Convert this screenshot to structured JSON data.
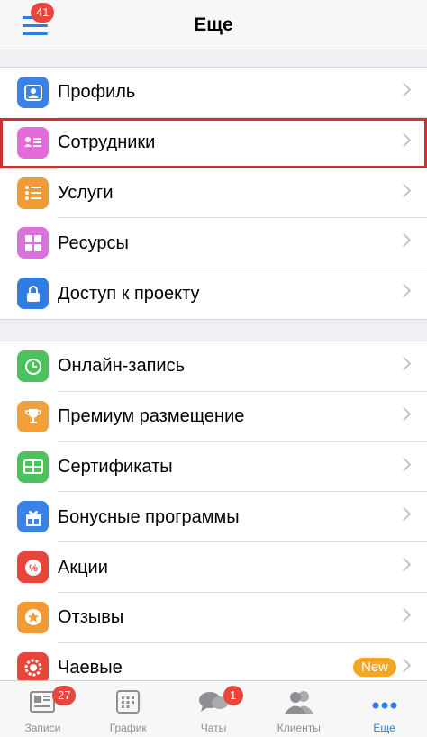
{
  "nav": {
    "title": "Еще",
    "menu_badge": "41"
  },
  "group1": [
    {
      "label": "Профиль",
      "icon": "profile-icon",
      "color": "#3b82e8"
    },
    {
      "label": "Сотрудники",
      "icon": "staff-card-icon",
      "color": "#e56bd8",
      "highlighted": true
    },
    {
      "label": "Услуги",
      "icon": "list-icon",
      "color": "#f29a33"
    },
    {
      "label": "Ресурсы",
      "icon": "grid-icon",
      "color": "#d873d9"
    },
    {
      "label": "Доступ к проекту",
      "icon": "lock-icon",
      "color": "#2f7de1"
    }
  ],
  "group2": [
    {
      "label": "Онлайн-запись",
      "icon": "clock-icon",
      "color": "#4cc25e"
    },
    {
      "label": "Премиум размещение",
      "icon": "trophy-icon",
      "color": "#f2a03a"
    },
    {
      "label": "Сертификаты",
      "icon": "certificate-icon",
      "color": "#4cc25e"
    },
    {
      "label": "Бонусные программы",
      "icon": "gift-icon",
      "color": "#3b82e8"
    },
    {
      "label": "Акции",
      "icon": "percent-icon",
      "color": "#e8453c"
    },
    {
      "label": "Отзывы",
      "icon": "star-icon",
      "color": "#f29a33"
    },
    {
      "label": "Чаевые",
      "icon": "tips-icon",
      "color": "#e8453c",
      "pill": "New"
    }
  ],
  "tabs": [
    {
      "label": "Записи",
      "icon": "records-icon",
      "badge": "27"
    },
    {
      "label": "График",
      "icon": "calendar-icon"
    },
    {
      "label": "Чаты",
      "icon": "chat-icon",
      "badge": "1"
    },
    {
      "label": "Клиенты",
      "icon": "clients-icon"
    },
    {
      "label": "Еще",
      "icon": "more-dots-icon",
      "active": true
    }
  ],
  "colors": {
    "accent": "#2f7de1",
    "badge": "#e8453c",
    "highlight_border": "#d32f2f"
  }
}
